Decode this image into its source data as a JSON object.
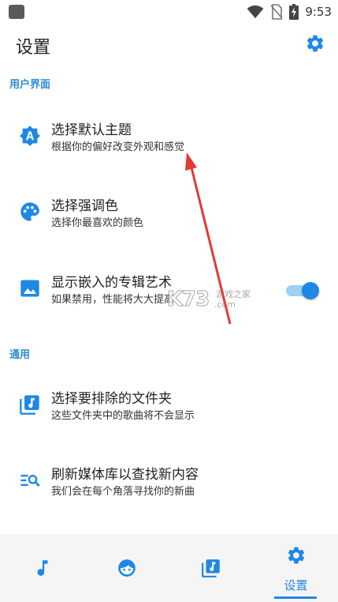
{
  "status_bar": {
    "time": "9:53",
    "icons": [
      "wifi-icon",
      "no-sim-icon",
      "battery-charging-icon"
    ]
  },
  "header": {
    "title": "设置",
    "settings_icon": "gear-icon"
  },
  "sections": [
    {
      "title": "用户界面",
      "items": [
        {
          "icon": "theme-auto-icon",
          "title": "选择默认主题",
          "subtitle": "根据你的偏好改变外观和感觉"
        },
        {
          "icon": "palette-icon",
          "title": "选择强调色",
          "subtitle": "选择你最喜欢的颜色"
        },
        {
          "icon": "image-icon",
          "title": "显示嵌入的专辑艺术",
          "subtitle": "如果禁用，性能将大大提高",
          "toggle_on": true
        }
      ]
    },
    {
      "title": "通用",
      "items": [
        {
          "icon": "music-folder-icon",
          "title": "选择要排除的文件夹",
          "subtitle": "这些文件夹中的歌曲将不会显示"
        },
        {
          "icon": "search-list-icon",
          "title": "刷新媒体库以查找新内容",
          "subtitle": "我们会在每个角落寻找你的新曲"
        }
      ]
    }
  ],
  "watermark": {
    "logo": "K73",
    "text_cn": "游戏之家",
    "text_domain": ".com"
  },
  "bottom_nav": {
    "items": [
      {
        "icon": "music-note-icon",
        "label": ""
      },
      {
        "icon": "face-icon",
        "label": ""
      },
      {
        "icon": "music-library-icon",
        "label": ""
      },
      {
        "icon": "gear-icon",
        "label": "设置",
        "active": true
      }
    ]
  },
  "colors": {
    "accent": "#1e88e5",
    "section_title": "#2c8bd4",
    "arrow": "#e53935",
    "nav_background": "#f5f5f5"
  }
}
